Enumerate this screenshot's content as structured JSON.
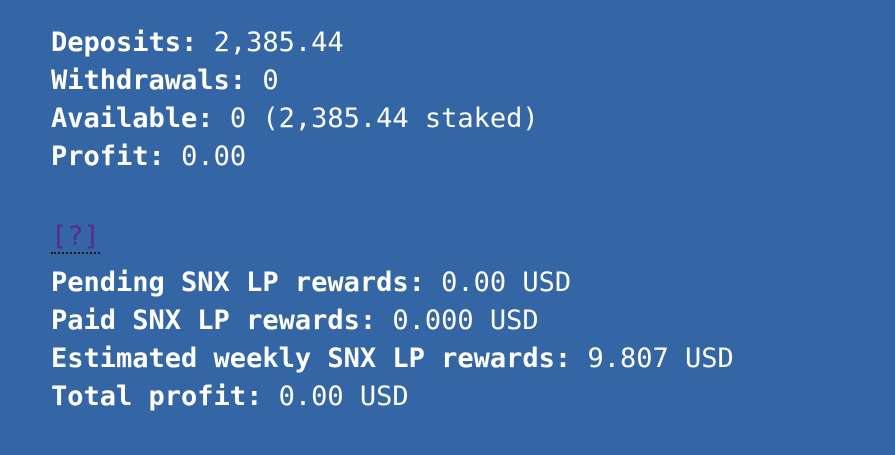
{
  "stats": {
    "deposits_label": "Deposits:",
    "deposits_value": "2,385.44",
    "withdrawals_label": "Withdrawals:",
    "withdrawals_value": "0",
    "available_label": "Available:",
    "available_value": "0 (2,385.44 staked)",
    "profit_label": "Profit:",
    "profit_value": "0.00"
  },
  "help": {
    "link_text": "[?]"
  },
  "rewards": {
    "pending_label": "Pending SNX LP rewards:",
    "pending_value": "0.00 USD",
    "paid_label": "Paid SNX LP rewards:",
    "paid_value": "0.000 USD",
    "weekly_label": "Estimated weekly SNX LP rewards:",
    "weekly_value": "9.807 USD",
    "total_label": "Total profit:",
    "total_value": "0.00 USD"
  },
  "colors": {
    "background": "#3465a4",
    "text": "#ffffff",
    "link": "#5c2a8c"
  }
}
